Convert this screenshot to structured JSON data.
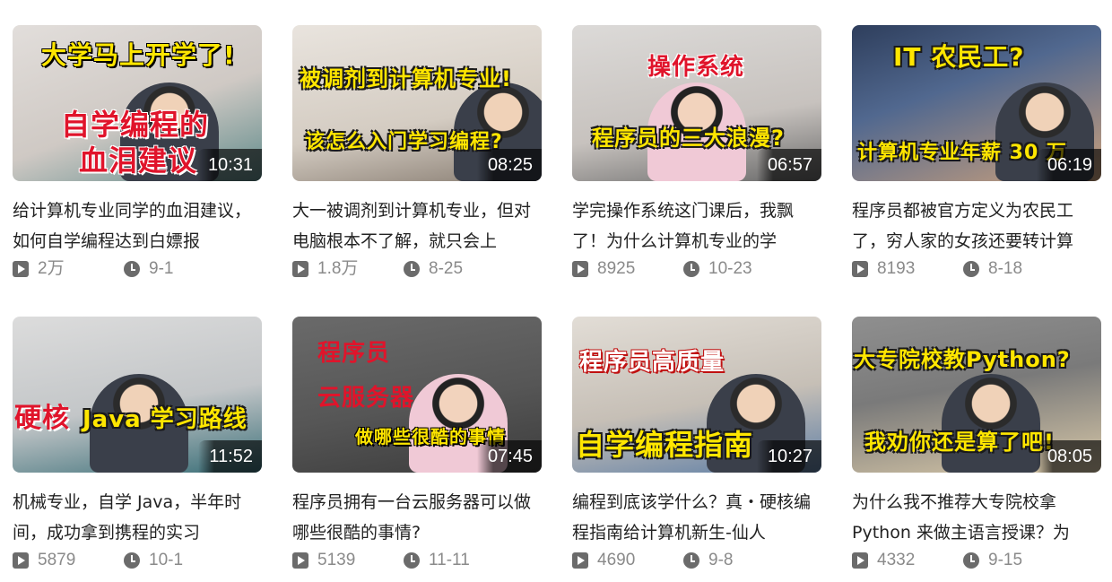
{
  "videos": [
    {
      "overlay": [
        "大学马上开学了!",
        "自学编程的",
        "血泪建议"
      ],
      "duration": "10:31",
      "title": "给计算机专业同学的血泪建议，如何自学编程达到白嫖报",
      "views": "2万",
      "date": "9-1"
    },
    {
      "overlay": [
        "被调剂到计算机专业!",
        "该怎么入门学习编程?"
      ],
      "duration": "08:25",
      "title": "大一被调剂到计算机专业，但对电脑根本不了解，就只会上",
      "views": "1.8万",
      "date": "8-25"
    },
    {
      "overlay": [
        "操作系统",
        "程序员的三大浪漫?"
      ],
      "duration": "06:57",
      "title": "学完操作系统这门课后，我飘了！为什么计算机专业的学",
      "views": "8925",
      "date": "10-23"
    },
    {
      "overlay": [
        "IT 农民工?",
        "计算机专业年薪 30 万"
      ],
      "duration": "06:19",
      "title": "程序员都被官方定义为农民工了，穷人家的女孩还要转计算",
      "views": "8193",
      "date": "8-18"
    },
    {
      "overlay": [
        "硬核",
        "Java 学习路线"
      ],
      "duration": "11:52",
      "title": "机械专业，自学 Java，半年时间，成功拿到携程的实习",
      "views": "5879",
      "date": "10-1"
    },
    {
      "overlay": [
        "程序员",
        "云服务器",
        "做哪些很酷的事情"
      ],
      "duration": "07:45",
      "title": "程序员拥有一台云服务器可以做哪些很酷的事情?",
      "views": "5139",
      "date": "11-11"
    },
    {
      "overlay": [
        "程序员高质量",
        "自学编程指南"
      ],
      "duration": "10:27",
      "title": "编程到底该学什么？真・硬核编程指南给计算机新生-仙人",
      "views": "4690",
      "date": "9-8"
    },
    {
      "overlay": [
        "大专院校教Python?",
        "我劝你还是算了吧!"
      ],
      "duration": "08:05",
      "title": "为什么我不推荐大专院校拿 Python 来做主语言授课？为",
      "views": "4332",
      "date": "9-15"
    }
  ]
}
